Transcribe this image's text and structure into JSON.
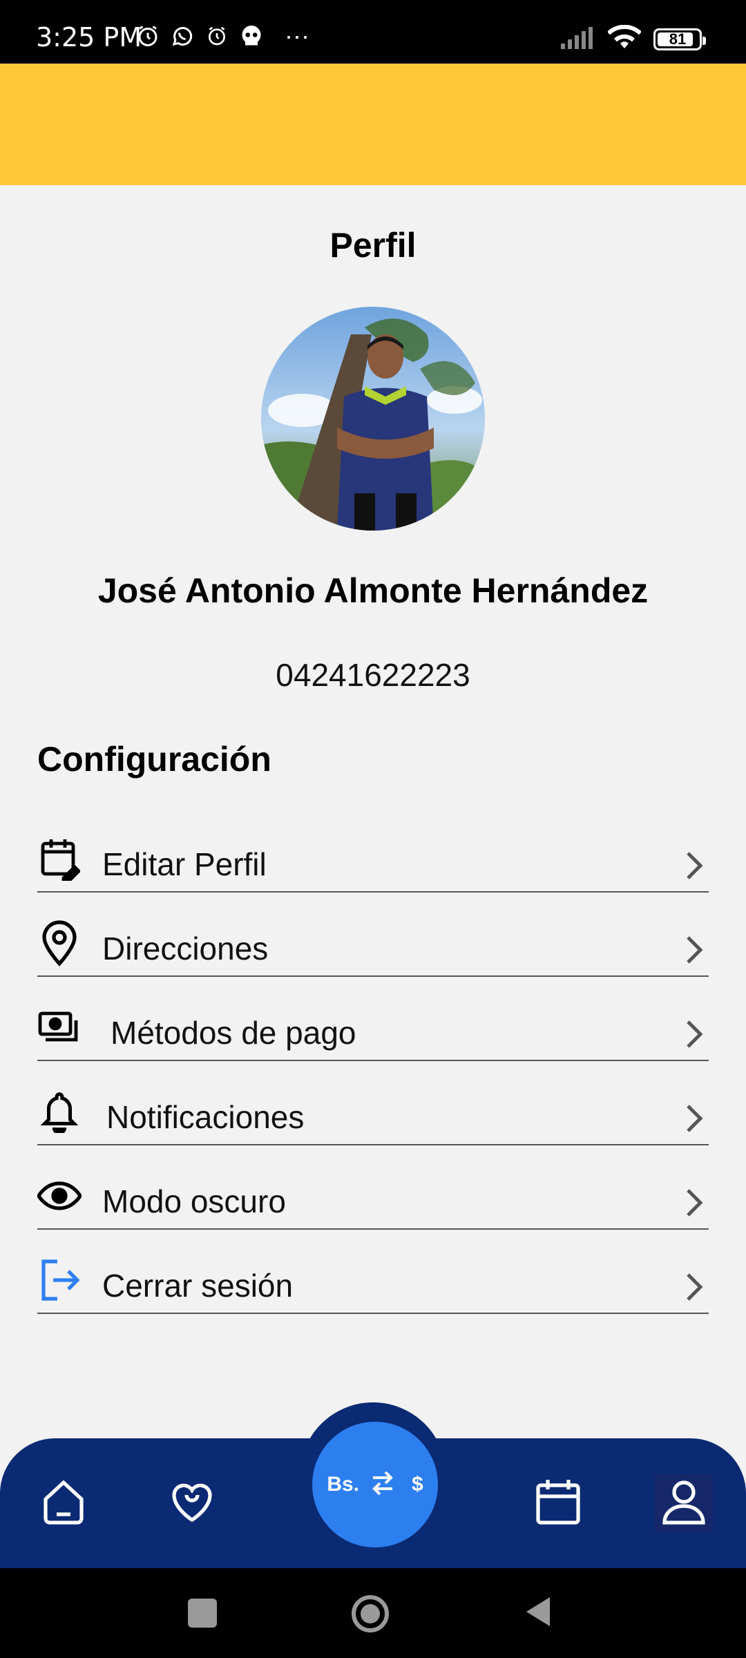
{
  "status_bar": {
    "time": "3:25 PM",
    "icons": [
      "alarm-icon",
      "whatsapp-icon",
      "alarm-icon",
      "skull-icon"
    ],
    "more": "···",
    "battery_level": "81"
  },
  "colors": {
    "header_yellow": "#ffc638",
    "nav_navy": "#0a2a73",
    "accent_blue": "#2d7ff0",
    "background": "#f2f2f2"
  },
  "profile": {
    "title": "Perfil",
    "name": "José Antonio Almonte Hernández",
    "phone": "04241622223"
  },
  "settings": {
    "title": "Configuración",
    "items": [
      {
        "label": "Editar Perfil",
        "icon": "calendar-edit-icon"
      },
      {
        "label": "Direcciones",
        "icon": "location-pin-icon"
      },
      {
        "label": "Métodos de pago",
        "icon": "payment-icon"
      },
      {
        "label": "Notificaciones",
        "icon": "bell-icon"
      },
      {
        "label": "Modo oscuro",
        "icon": "eye-icon"
      },
      {
        "label": "Cerrar sesión",
        "icon": "logout-icon"
      }
    ]
  },
  "bottom_nav": {
    "items": [
      "home-icon",
      "heart-icon",
      "calendar-icon",
      "user-icon"
    ],
    "center": {
      "left": "Bs.",
      "right": "$",
      "icon": "exchange-arrows-icon"
    }
  }
}
